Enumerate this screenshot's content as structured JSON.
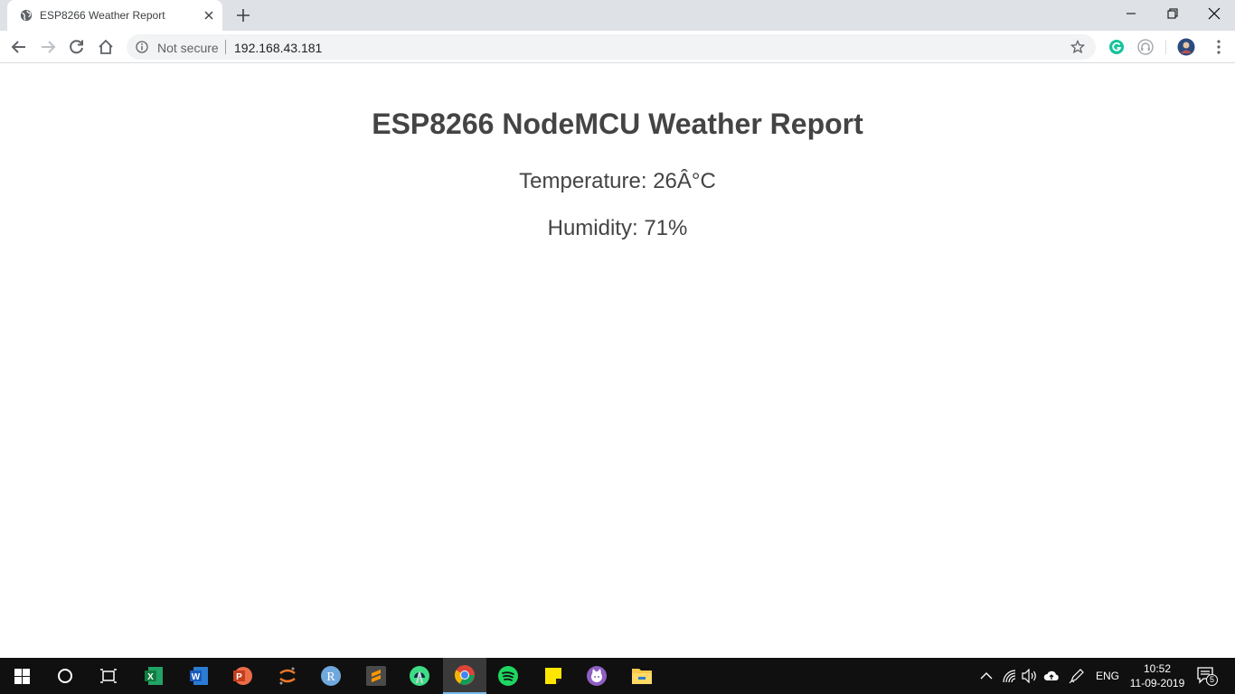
{
  "browser": {
    "tab_title": "ESP8266 Weather Report",
    "security_label": "Not secure",
    "url": "192.168.43.181"
  },
  "page": {
    "heading": "ESP8266 NodeMCU Weather Report",
    "temperature": "Temperature: 26Â°C",
    "humidity": "Humidity: 71%"
  },
  "taskbar": {
    "apps": [
      "start",
      "cortana-search",
      "task-view",
      "excel",
      "word",
      "powerpoint",
      "jupyter",
      "r",
      "sublime-text",
      "android-studio",
      "chrome",
      "spotify",
      "sticky-notes",
      "github-desktop",
      "file-explorer"
    ],
    "active_app": "chrome",
    "language": "ENG",
    "time": "10:52",
    "date": "11-09-2019",
    "notification_count": "5"
  },
  "colors": {
    "tab_strip": "#dee1e6",
    "omnibox": "#f1f3f4",
    "page_text": "#444444",
    "taskbar": "#101010"
  }
}
